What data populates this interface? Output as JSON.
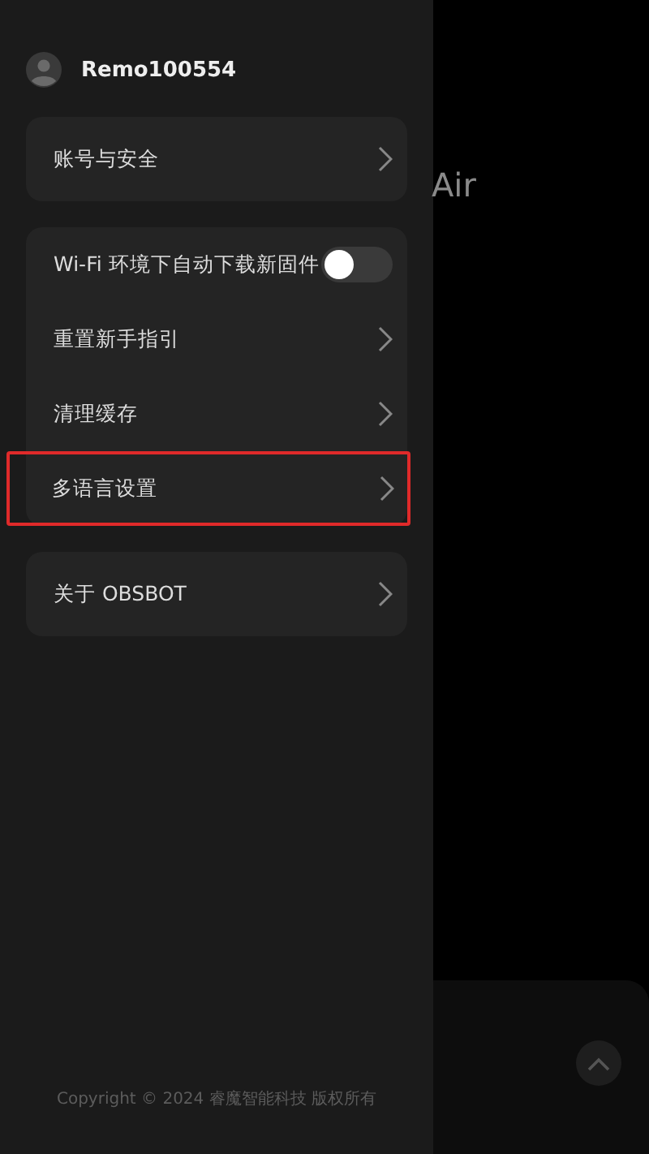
{
  "drawer": {
    "user": {
      "name": "Remo100554"
    },
    "groups": [
      {
        "items": [
          {
            "kind": "link",
            "label": "账号与安全",
            "highlighted": false
          }
        ]
      },
      {
        "items": [
          {
            "kind": "toggle",
            "label": "Wi-Fi 环境下自动下载新固件",
            "on": false
          },
          {
            "kind": "link",
            "label": "重置新手指引",
            "highlighted": false
          },
          {
            "kind": "link",
            "label": "清理缓存",
            "highlighted": false
          },
          {
            "kind": "link",
            "label": "多语言设置",
            "highlighted": true
          }
        ]
      },
      {
        "items": [
          {
            "kind": "link",
            "label": "关于 OBSBOT",
            "highlighted": false
          }
        ]
      }
    ],
    "copyright": "Copyright © 2024 睿魔智能科技 版权所有"
  },
  "background": {
    "title_fragment": "Air"
  }
}
